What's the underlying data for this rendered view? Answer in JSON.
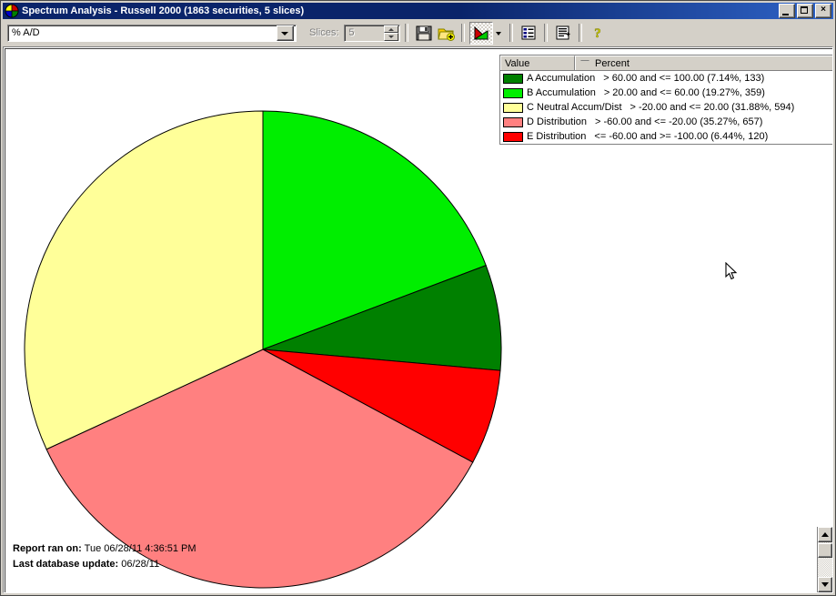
{
  "window": {
    "title": "Spectrum Analysis - Russell 2000 (1863 securities, 5 slices)",
    "icon": "pie-chart-icon",
    "minimize_label": "_",
    "maximize_label": "",
    "close_label": "×"
  },
  "toolbar": {
    "indicator_combo": {
      "value": "% A/D",
      "icon": "chevron-down-icon"
    },
    "slices_label": "Slices:",
    "slices_value": "5",
    "buttons": [
      {
        "name": "save-button",
        "icon": "floppy-disk-icon",
        "label": "Save"
      },
      {
        "name": "open-button",
        "icon": "open-folder-add-icon",
        "label": "Open"
      },
      {
        "name": "chart-type-button",
        "icon": "pie-chart-icon",
        "label": "Chart",
        "pressed": true
      },
      {
        "name": "chart-type-dropdown",
        "icon": "chevron-down-icon",
        "label": "Chart type"
      },
      {
        "name": "list-view-button",
        "icon": "list-icon",
        "label": "List view"
      },
      {
        "name": "report-view-button",
        "icon": "report-icon",
        "label": "Report view"
      },
      {
        "name": "help-button",
        "icon": "question-mark-icon",
        "label": "Help"
      }
    ]
  },
  "legend": {
    "columns": [
      "Value",
      "Percent"
    ],
    "sort_indicator": "ascending-triangle-icon",
    "rows": [
      {
        "color": "#008000",
        "name": "A Accumulation",
        "range": "> 60.00 and <= 100.00 (7.14%, 133)"
      },
      {
        "color": "#00ee00",
        "name": "B Accumulation",
        "range": "> 20.00 and <= 60.00 (19.27%, 359)"
      },
      {
        "color": "#ffff99",
        "name": "C Neutral Accum/Dist",
        "range": "> -20.00 and <= 20.00 (31.88%, 594)"
      },
      {
        "color": "#ff8080",
        "name": "D Distribution",
        "range": "> -60.00 and <= -20.00 (35.27%, 657)"
      },
      {
        "color": "#ff0000",
        "name": "E Distribution",
        "range": "<= -60.00 and >= -100.00 (6.44%, 120)"
      }
    ]
  },
  "footer": {
    "report_ran_label": "Report ran on:",
    "report_ran_value": "Tue 06/28/11 4:36:51 PM",
    "db_update_label": "Last database update:",
    "db_update_value": "06/28/11"
  },
  "scrollbar": {
    "up_icon": "scroll-up-arrow-icon",
    "down_icon": "scroll-down-arrow-icon"
  },
  "chart_data": {
    "type": "pie",
    "title": "Spectrum Analysis - Russell 2000",
    "center": [
      283,
      330
    ],
    "radius": 262,
    "start_angle_deg": 90,
    "direction": "clockwise",
    "total_securities": 1863,
    "slice_count": 5,
    "categories": [
      "A Accumulation",
      "B Accumulation",
      "C Neutral Accum/Dist",
      "D Distribution",
      "E Distribution"
    ],
    "values": [
      7.14,
      19.27,
      31.88,
      35.27,
      6.44
    ],
    "counts": [
      133,
      359,
      594,
      657,
      120
    ],
    "colors": [
      "#008000",
      "#00ee00",
      "#ffff99",
      "#ff8080",
      "#ff0000"
    ],
    "slice_order": [
      "B Accumulation",
      "A Accumulation",
      "E Distribution",
      "D Distribution",
      "C Neutral Accum/Dist"
    ],
    "ranges": [
      "> 60.00 and <= 100.00",
      "> 20.00 and <= 60.00",
      "> -20.00 and <= 20.00",
      "> -60.00 and <= -20.00",
      "<= -60.00 and >= -100.00"
    ],
    "legend_position": "top-right",
    "grid": false,
    "xlabel": "",
    "ylabel": ""
  }
}
